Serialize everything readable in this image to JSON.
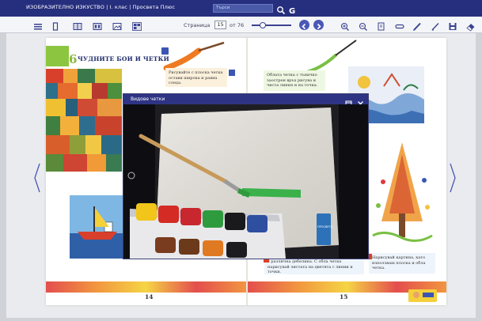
{
  "titlebar": {
    "app_title": "ИЗОБРАЗИТЕЛНО ИЗКУСТВО | I. клас | Просвета Плюс",
    "search_placeholder": "Търси"
  },
  "toolbar": {
    "page_label": "Страница",
    "current_page": "15",
    "of_total": "от 76"
  },
  "lesson": {
    "number": "6",
    "title": "ЧУДНИТЕ БОИ И ЧЕТКИ",
    "box_left": "Рисувайте с плоска четка остави широка и равна следа.",
    "box_right": "Облата четка с тъничко заострен връх рисува и чиста линия и на точка.",
    "box_bottom_left": "с различна дебелина. С обла четка нарисувай листата на цветята с линии и точки.",
    "box_bottom_right": "Нарисувай картина, като използваш плоска и обла четка.",
    "page_left": "14",
    "page_right": "15"
  },
  "video": {
    "title": "Видове четки",
    "box_brand": "ПРОСВЕТА"
  },
  "colors": {
    "title_bar": "#262e7e",
    "accent_blue": "#4a58b6",
    "lesson_green": "#8cc640",
    "video_header": "#2e3483"
  }
}
